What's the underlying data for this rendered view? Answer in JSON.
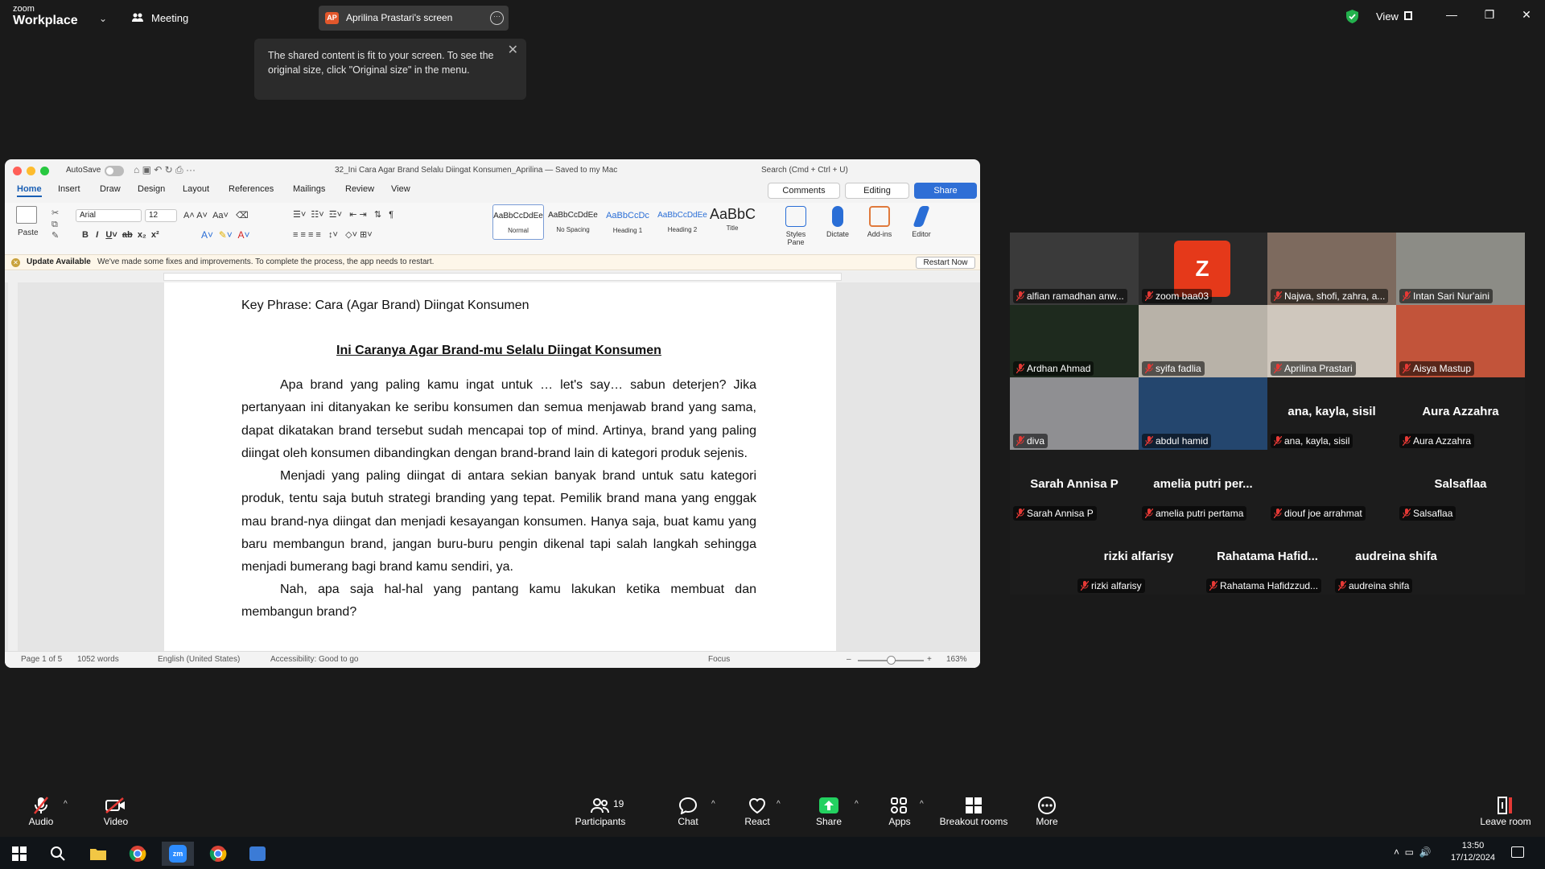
{
  "topbar": {
    "logo_small": "zoom",
    "logo_big": "Workplace",
    "meeting_label": "Meeting",
    "share_initials": "AP",
    "screen_title": "Aprilina Prastari's screen",
    "view_label": "View"
  },
  "tooltip": {
    "text": "The shared content is fit to your screen. To see the original size, click \"Original size\" in the menu."
  },
  "word": {
    "autosave_label": "AutoSave",
    "doc_title": "32_Ini Cara Agar Brand Selalu Diingat Konsumen_Aprilina — Saved to my Mac",
    "search_placeholder": "Search (Cmd + Ctrl + U)",
    "tabs": [
      "Home",
      "Insert",
      "Draw",
      "Design",
      "Layout",
      "References",
      "Mailings",
      "Review",
      "View"
    ],
    "comments_label": "Comments",
    "editing_label": "Editing",
    "share_label": "Share",
    "paste_label": "Paste",
    "font_name": "Arial",
    "font_size": "12",
    "styles": [
      {
        "sample": "AaBbCcDdEe",
        "name": "Normal"
      },
      {
        "sample": "AaBbCcDdEe",
        "name": "No Spacing"
      },
      {
        "sample": "AaBbCcDc",
        "name": "Heading 1"
      },
      {
        "sample": "AaBbCcDdEe",
        "name": "Heading 2"
      },
      {
        "sample": "AaBbC",
        "name": "Title"
      }
    ],
    "styles_pane_label": "Styles Pane",
    "dictate_label": "Dictate",
    "addins_label": "Add-ins",
    "editor_label": "Editor",
    "update_title": "Update Available",
    "update_msg": "We've made some fixes and improvements. To complete the process, the app needs to restart.",
    "restart_label": "Restart Now",
    "key_phrase": "Key Phrase: Cara (Agar Brand) Diingat Konsumen",
    "heading": "Ini Caranya Agar Brand-mu Selalu Diingat Konsumen",
    "paragraph1": "Apa brand yang paling kamu ingat untuk … let's say… sabun deterjen? Jika pertanyaan ini ditanyakan ke seribu konsumen dan semua menjawab brand yang sama, dapat dikatakan brand tersebut sudah mencapai top of mind. Artinya, brand yang paling diingat oleh konsumen dibandingkan dengan brand-brand lain di kategori produk sejenis.",
    "paragraph2": "Menjadi yang paling diingat di antara sekian banyak brand untuk satu kategori produk, tentu saja butuh strategi branding yang tepat. Pemilik brand mana yang enggak mau brand-nya diingat dan menjadi kesayangan konsumen. Hanya saja, buat kamu yang baru membangun brand, jangan buru-buru pengin dikenal tapi salah langkah sehingga menjadi bumerang bagi brand kamu sendiri, ya.",
    "paragraph3": "Nah, apa saja hal-hal yang pantang kamu lakukan ketika membuat dan membangun brand?",
    "status_page": "Page 1 of 5",
    "status_words": "1052 words",
    "status_lang": "English (United States)",
    "status_access": "Accessibility: Good to go",
    "status_focus": "Focus",
    "status_zoom": "163%"
  },
  "gallery": {
    "tiles": [
      {
        "name": "alfian ramadhan anw...",
        "color": "#3a3a3a"
      },
      {
        "name": "zoom baa03",
        "avatar": "Z",
        "color": "#2a2a2a"
      },
      {
        "name": "Najwa, shofi, zahra, a...",
        "color": "#7d6a5e"
      },
      {
        "name": "Intan Sari Nur'aini",
        "color": "#8c8c86"
      },
      {
        "name": "Ardhan Ahmad",
        "color": "#1e2a1e"
      },
      {
        "name": "syifa fadlia",
        "color": "#b8b2a8"
      },
      {
        "name": "Aprilina Prastari",
        "color": "#cfc7bd"
      },
      {
        "name": "Aisya Mastup",
        "color": "#c2543a"
      },
      {
        "name": "diva",
        "color": "#8f8f92"
      },
      {
        "name": "abdul hamid",
        "color": "#24466e"
      },
      {
        "name": "ana, kayla, sisil",
        "big": "ana, kayla, sisil"
      },
      {
        "name": "Aura Azzahra",
        "big": "Aura Azzahra"
      },
      {
        "name": "Sarah Annisa P",
        "big": "Sarah Annisa P"
      },
      {
        "name": "amelia putri pertama",
        "big": "amelia  putri  per..."
      },
      {
        "name": "diouf joe arrahmat",
        "color": "#1c1c1c"
      },
      {
        "name": "Salsaflaa",
        "big": "Salsaflaa"
      },
      {
        "name": "rizki alfarisy",
        "big": "rizki alfarisy"
      },
      {
        "name": "Rahatama Hafidzzud...",
        "big": "Rahatama  Hafid..."
      },
      {
        "name": "audreina shifa",
        "big": "audreina shifa"
      }
    ]
  },
  "toolbar": {
    "audio": "Audio",
    "video": "Video",
    "participants": "Participants",
    "participants_count": "19",
    "chat": "Chat",
    "react": "React",
    "share": "Share",
    "apps": "Apps",
    "breakout": "Breakout rooms",
    "more": "More",
    "leave": "Leave room"
  },
  "taskbar": {
    "time": "13:50",
    "date": "17/12/2024"
  }
}
